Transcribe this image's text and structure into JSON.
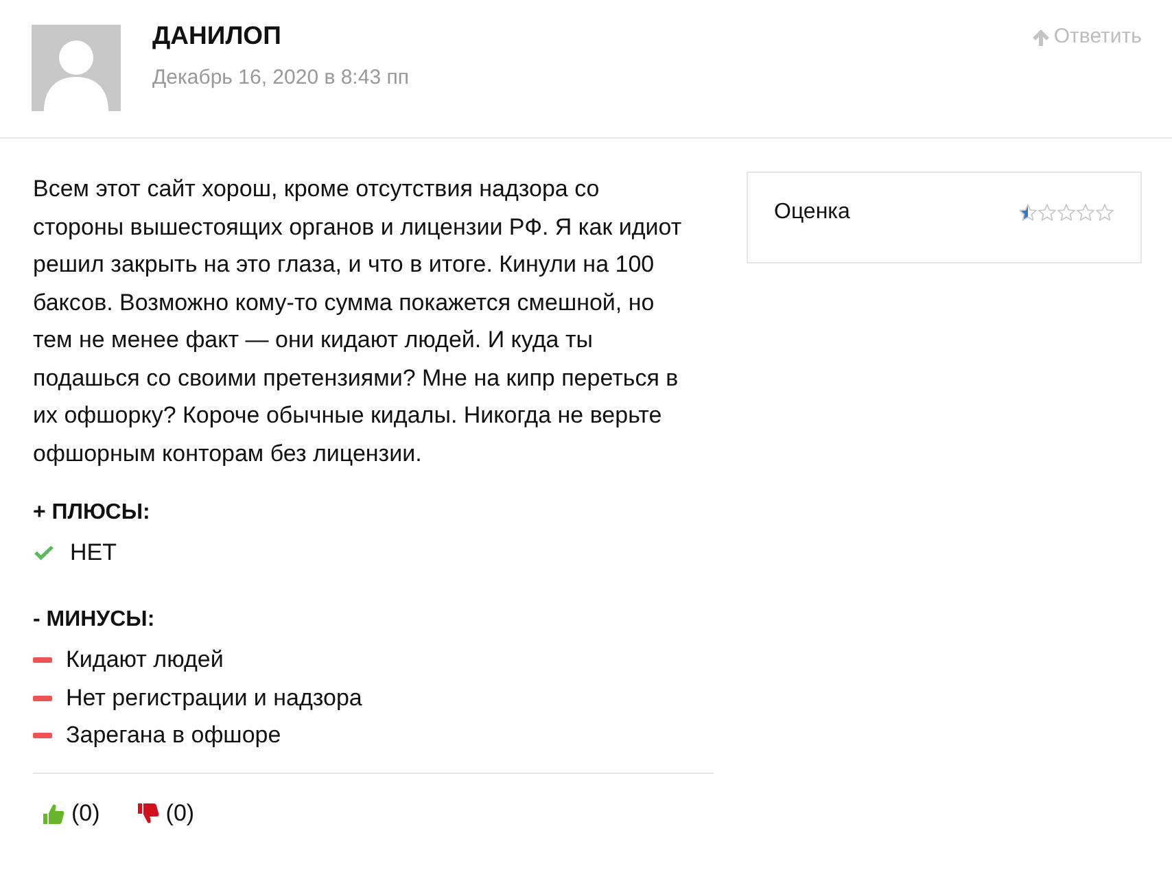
{
  "comment": {
    "author": "ДАНИЛОП",
    "date": "Декабрь 16, 2020 в 8:43 пп",
    "reply_button": {
      "label": "Ответить"
    }
  },
  "body": "Всем этот сайт хорош, кроме отсутствия надзора со стороны вышестоящих органов и лицензии РФ. Я как идиот решил закрыть на это глаза, и что в итоге. Кинули на 100 баксов. Возможно кому-то сумма покажется смешной, но тем не менее факт — они кидают людей. И куда ты подашься со своими претензиями? Мне на кипр переться в их офшорку? Короче обычные кидалы. Никогда не верьте офшорным конторам без лицензии.",
  "rating": {
    "label": "Оценка",
    "stars": 0.5
  },
  "pros": {
    "heading": "+ ПЛЮСЫ:",
    "items": [
      "НЕТ"
    ]
  },
  "cons": {
    "heading": "- МИНУСЫ:",
    "items": [
      "Кидают людей",
      "Нет регистрации и надзора",
      "Зарегана в офшоре"
    ]
  },
  "votes": [
    {
      "kind": "up",
      "count": "(0)"
    },
    {
      "kind": "down",
      "count": "(0)"
    }
  ]
}
